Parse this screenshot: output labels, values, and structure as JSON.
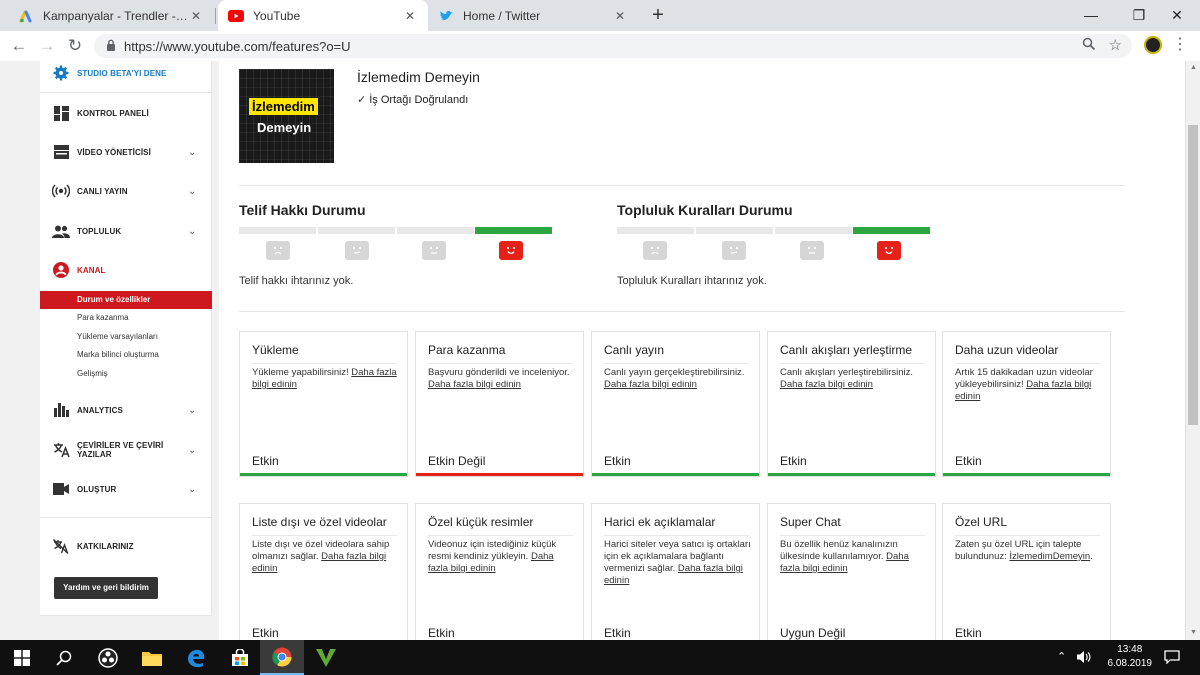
{
  "browser": {
    "tabs": [
      {
        "title": "Kampanyalar - Trendler - Google",
        "favicon": "google-ads-icon",
        "active": false
      },
      {
        "title": "YouTube",
        "favicon": "youtube-icon",
        "active": true
      },
      {
        "title": "Home / Twitter",
        "favicon": "twitter-icon",
        "active": false
      }
    ],
    "new_tab": "+",
    "url": "https://www.youtube.com/features?o=U",
    "window_controls": {
      "minimize": "—",
      "maximize": "❐",
      "close": "✕"
    }
  },
  "sidebar": {
    "studio_beta": "STUDIO BETA'YI DENE",
    "items": [
      {
        "label": "KONTROL PANELİ"
      },
      {
        "label": "VİDEO YÖNETİCİSİ"
      },
      {
        "label": "CANLI YAYIN"
      },
      {
        "label": "TOPLULUK"
      },
      {
        "label": "KANAL"
      }
    ],
    "sub_items": [
      {
        "label": "Durum ve özellikler"
      },
      {
        "label": "Para kazanma"
      },
      {
        "label": "Yükleme varsayılanları"
      },
      {
        "label": "Marka bilinci oluşturma"
      },
      {
        "label": "Gelişmiş"
      }
    ],
    "items2": [
      {
        "label": "ANALYTICS"
      },
      {
        "label": "ÇEVİRİLER VE ÇEVİRİ YAZILAR"
      },
      {
        "label": "OLUŞTUR"
      }
    ],
    "contributions": "KATKILARINIZ",
    "help_button": "Yardım ve geri bildirim"
  },
  "channel": {
    "thumb_line1": "İzlemedim",
    "thumb_line2": "Demeyin",
    "name": "İzlemedim Demeyin",
    "verified": "İş Ortağı Doğrulandı"
  },
  "copyright": {
    "title": "Telif Hakkı Durumu",
    "text": "Telif hakkı ihtarınız yok."
  },
  "community": {
    "title": "Topluluk Kuralları Durumu",
    "text": "Topluluk Kuralları ihtarınız yok."
  },
  "features_row1": [
    {
      "title": "Yükleme",
      "desc": "Yükleme yapabilirsiniz! ",
      "link": "Daha fazla bilgi edinin",
      "status": "Etkin",
      "state": "green"
    },
    {
      "title": "Para kazanma",
      "desc": "Başvuru gönderildi ve inceleniyor. ",
      "link": "Daha fazla bilgi edinin",
      "status": "Etkin Değil",
      "state": "red"
    },
    {
      "title": "Canlı yayın",
      "desc": "Canlı yayın gerçekleştirebilirsiniz. ",
      "link": "Daha fazla bilgi edinin",
      "status": "Etkin",
      "state": "green"
    },
    {
      "title": "Canlı akışları yerleştirme",
      "desc": "Canlı akışları yerleştirebilirsiniz. ",
      "link": "Daha fazla bilgi edinin",
      "status": "Etkin",
      "state": "green"
    },
    {
      "title": "Daha uzun videolar",
      "desc": "Artık 15 dakikadan uzun videolar yükleyebilirsiniz! ",
      "link": "Daha fazla bilgi edinin",
      "status": "Etkin",
      "state": "green"
    }
  ],
  "features_row2": [
    {
      "title": "Liste dışı ve özel videolar",
      "desc": "Liste dışı ve özel videolara sahip olmanızı sağlar. ",
      "link": "Daha fazla bilgi edinin",
      "status": "Etkin"
    },
    {
      "title": "Özel küçük resimler",
      "desc": "Videonuz için istediğiniz küçük resmi kendiniz yükleyin. ",
      "link": "Daha fazla bilgi edinin",
      "status": "Etkin"
    },
    {
      "title": "Harici ek açıklamalar",
      "desc": "Harici siteler veya satıcı iş ortakları için ek açıklamalara bağlantı vermenizi sağlar. ",
      "link": "Daha fazla bilgi edinin",
      "status": "Etkin"
    },
    {
      "title": "Super Chat",
      "desc": "Bu özellik henüz kanalınızın ülkesinde kullanılamıyor. ",
      "link": "Daha fazla bilgi edinin",
      "status": "Uygun Değil"
    },
    {
      "title": "Özel URL",
      "desc": "Zaten şu özel URL için talepte bulundunuz: ",
      "link": "İzlemedimDemeyin",
      "status": "Etkin"
    }
  ],
  "colors": {
    "green": "#2ba640",
    "red": "#e62117",
    "blue": "#167ac6"
  },
  "taskbar": {
    "time": "13:48",
    "date": "6.08.2019"
  }
}
